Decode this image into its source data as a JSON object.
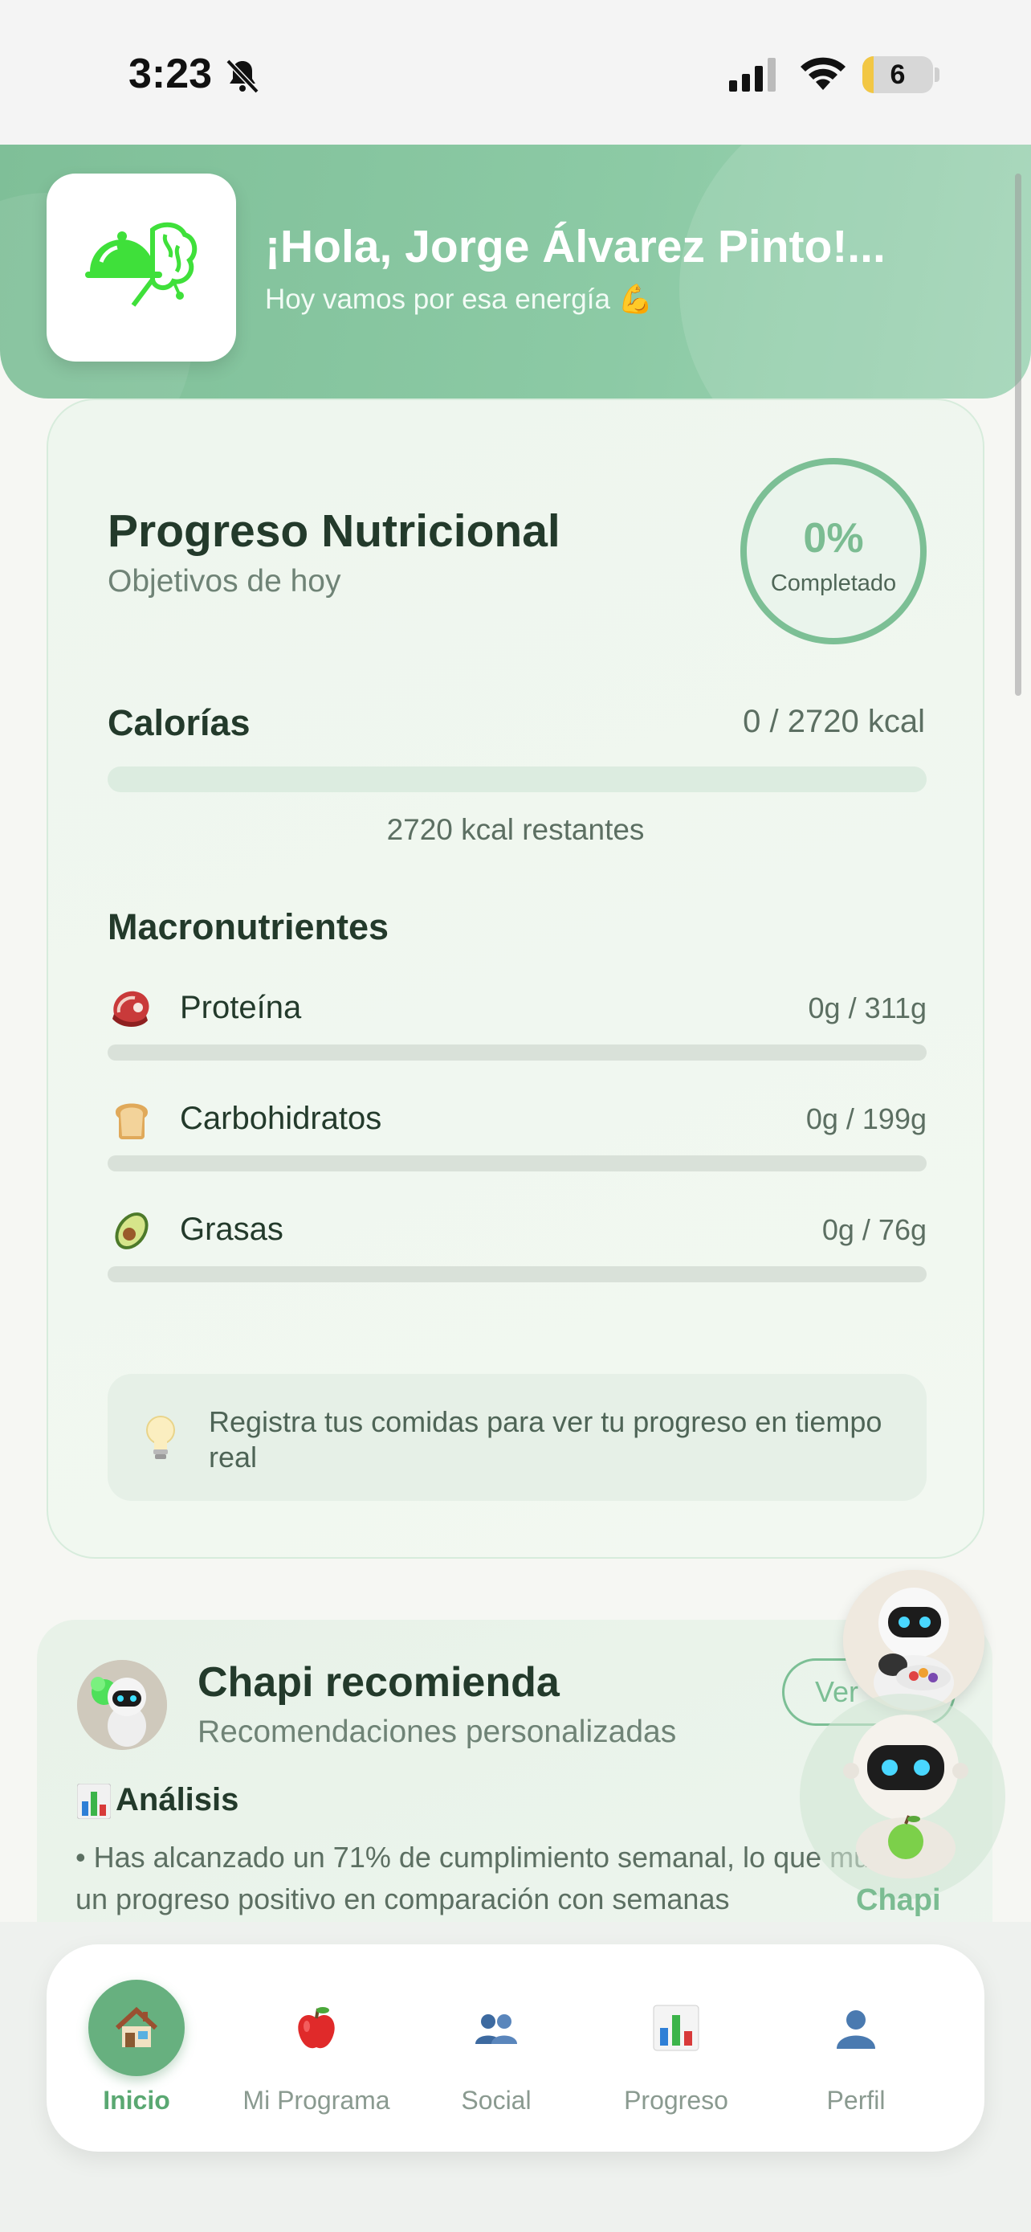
{
  "status_bar": {
    "time": "3:23",
    "battery": "6"
  },
  "header": {
    "greeting": "¡Hola, Jorge Álvarez Pinto!...",
    "subtitle": "Hoy vamos por esa energía 💪"
  },
  "progress": {
    "title": "Progreso Nutricional",
    "subtitle": "Objetivos de hoy",
    "percent": "0%",
    "percent_label": "Completado",
    "calories_label": "Calorías",
    "calories_value": "0 / 2720 kcal",
    "calories_fraction": 0,
    "calories_remaining": "2720 kcal restantes",
    "macros_title": "Macronutrientes",
    "macros": [
      {
        "name": "Proteína",
        "value": "0g / 311g",
        "icon": "meat-icon",
        "fraction": 0
      },
      {
        "name": "Carbohidratos",
        "value": "0g / 199g",
        "icon": "bread-icon",
        "fraction": 0
      },
      {
        "name": "Grasas",
        "value": "0g / 76g",
        "icon": "avocado-icon",
        "fraction": 0
      }
    ],
    "tip": "Registra tus comidas para ver tu progreso en tiempo real"
  },
  "chapi": {
    "title": "Chapi recomienda",
    "subtitle": "Recomendaciones personalizadas",
    "button": "Ver",
    "analysis_title": "Análisis",
    "analysis_text": "• Has alcanzado un 71% de cumplimiento semanal, lo que muestra un progreso positivo en comparación con semanas",
    "floating_label": "Chapi"
  },
  "nav": {
    "items": [
      {
        "label": "Inicio",
        "icon": "house-icon",
        "active": true
      },
      {
        "label": "Mi Programa",
        "icon": "apple-icon",
        "active": false
      },
      {
        "label": "Social",
        "icon": "people-icon",
        "active": false
      },
      {
        "label": "Progreso",
        "icon": "bar-chart-icon",
        "active": false
      },
      {
        "label": "Perfil",
        "icon": "person-icon",
        "active": false
      }
    ]
  },
  "colors": {
    "accent": "#7cbf95",
    "header": "#8ccaa5",
    "logo_green": "#3fe03a"
  }
}
